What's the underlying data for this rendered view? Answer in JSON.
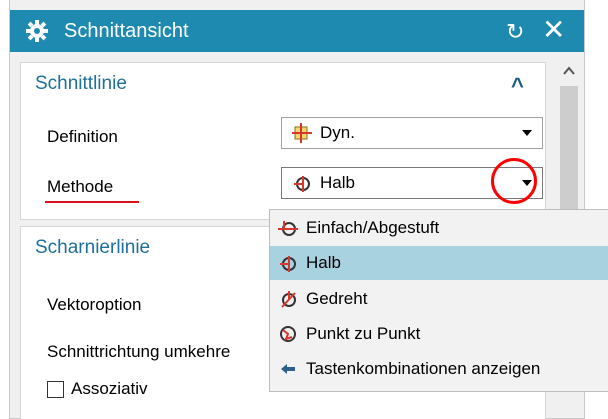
{
  "dialog": {
    "title": "Schnittansicht"
  },
  "section1": {
    "title": "Schnittlinie",
    "definition_label": "Definition",
    "definition_value": "Dyn.",
    "method_label": "Methode",
    "method_value": "Halb"
  },
  "section2": {
    "title": "Scharnierlinie",
    "vector_label": "Vektoroption",
    "reverse_label": "Schnittrichtung umkehre",
    "assoc_label": "Assoziativ",
    "assoc_checked": false
  },
  "dropdown": {
    "items": [
      {
        "label": "Einfach/Abgestuft",
        "icon": "simple-stepped-icon",
        "selected": false
      },
      {
        "label": "Halb",
        "icon": "half-section-icon",
        "selected": true
      },
      {
        "label": "Gedreht",
        "icon": "rotated-icon",
        "selected": false
      },
      {
        "label": "Punkt zu Punkt",
        "icon": "point-to-point-icon",
        "selected": false
      },
      {
        "label": "Tastenkombinationen anzeigen",
        "icon": "arrow-left-icon",
        "selected": false
      }
    ]
  },
  "colors": {
    "titlebar": "#1e8ab0",
    "section_title": "#1e6f9a",
    "highlight": "#a9d2e0",
    "annotation": "#ff0000"
  }
}
